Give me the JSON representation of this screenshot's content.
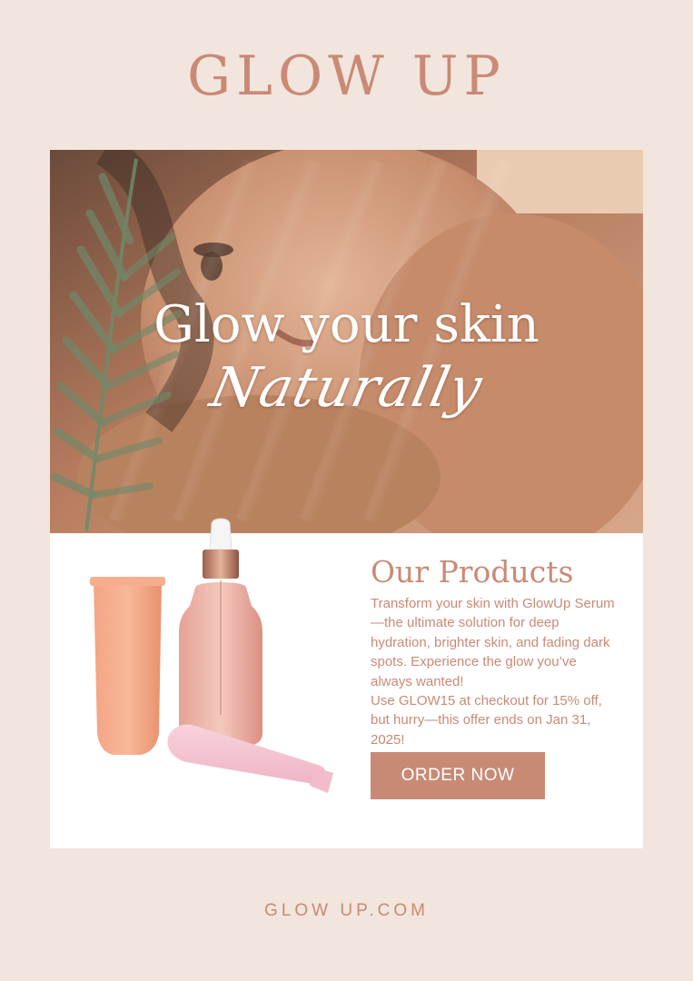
{
  "brand": {
    "title": "GLOW UP",
    "url": "GLOW UP.COM"
  },
  "hero": {
    "headline": "Glow your skin",
    "script_word": "Naturally",
    "image": "woman-portrait-with-palm-leaf"
  },
  "products": {
    "title": "Our Products",
    "description_lines": [
      "Transform your skin with GlowUp Serum—the ultimate solution for deep hydration, brighter skin, and fading dark spots. Experience the glow you’ve always wanted!",
      "Use GLOW15 at checkout for 15% off, but hurry—this offer ends on Jan 31, 2025!"
    ],
    "order_button": "ORDER NOW",
    "image": "skincare-tubes-and-serum-bottle"
  },
  "colors": {
    "page_background": "#f2e5dd",
    "accent": "#c98a75",
    "card_background": "#ffffff",
    "text_on_accent": "#ffffff"
  }
}
